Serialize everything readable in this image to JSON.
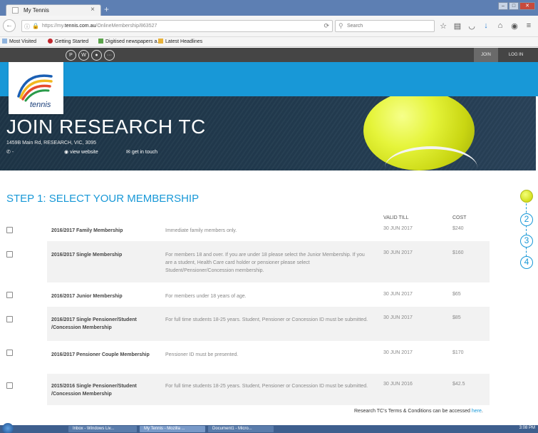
{
  "browser": {
    "tab_title": "My Tennis",
    "tab_close": "×",
    "new_tab": "+",
    "url_prefix": "https://my.",
    "url_host": "tennis.com.au",
    "url_path": "/OnlineMembership/863527",
    "search_placeholder": "Search",
    "bookmarks": [
      "Most Visited",
      "Getting Started",
      "Digitised newspapers a...",
      "Latest Headlines"
    ]
  },
  "site": {
    "join_label": "JOIN",
    "login_label": "LOG IN",
    "logo_text": "tennis",
    "club_title": "JOIN RESEARCH TC",
    "address": "1459B Main Rd, RESEARCH, VIC, 3095",
    "phone": "-",
    "view_website": "view website",
    "get_in_touch": "get in touch"
  },
  "membership": {
    "step_title": "STEP 1: SELECT YOUR MEMBERSHIP",
    "col_valid": "VALID TILL",
    "col_cost": "COST",
    "rows": [
      {
        "name": "2016/2017 Family Membership",
        "desc": "Immediate family members only.",
        "valid": "30 JUN 2017",
        "cost": "$240"
      },
      {
        "name": "2016/2017 Single Membership",
        "desc": "For members 18 and over. If you are under 18 please select the Junior Membership. If you are a student, Health Care card holder or pensioner please select Student/Pensioner/Concession membership.",
        "valid": "30 JUN 2017",
        "cost": "$160"
      },
      {
        "name": "2016/2017 Junior Membership",
        "desc": "For members under 18 years of age.",
        "valid": "30 JUN 2017",
        "cost": "$65"
      },
      {
        "name": "2016/2017 Single Pensioner/Student /Concession Membership",
        "desc": "For full time students 18-25 years. Student, Pensioner or Concession ID must be submitted.",
        "valid": "30 JUN 2017",
        "cost": "$85"
      },
      {
        "name": "2016/2017 Pensioner Couple Membership",
        "desc": "Pensioner ID must be presented.",
        "valid": "30 JUN 2017",
        "cost": "$170"
      },
      {
        "name": "2015/2016 Single Pensioner/Student /Concession Membership",
        "desc": "For full time students 18-25 years. Student, Pensioner or Concession ID must be submitted.",
        "valid": "30 JUN 2016",
        "cost": "$42.5"
      }
    ],
    "terms_text": "Research TC's Terms & Conditions can be accessed ",
    "terms_link": "here",
    "terms_end": "."
  },
  "steps": [
    "2",
    "3",
    "4"
  ],
  "taskbar": {
    "items": [
      "Inbox - Windows Liv...",
      "My Tennis - Mozilla ...",
      "Document1 - Micro..."
    ],
    "time": "3:08 PM"
  },
  "colors": {
    "accent": "#1898d7",
    "ball": "#e5f43a",
    "hero": "#223b4f"
  }
}
